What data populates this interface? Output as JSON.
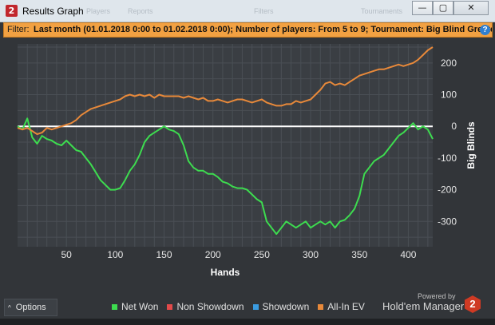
{
  "window": {
    "title": "Results Graph",
    "app_icon_text": "2",
    "background_menu_ghost": [
      "Players",
      "Reports",
      "Filters",
      "Tournaments"
    ],
    "controls": {
      "minimize": "—",
      "maximize": "▢",
      "close": "✕"
    }
  },
  "filter_bar": {
    "label": "Filter:",
    "text": "Last month (01.01.2018 0:00 to 01.02.2018 0:00); Number of players: From 5 to 9; Tournament: Big Blind Greater",
    "info_icon_text": "?",
    "color": "#f2a142"
  },
  "chart_data": {
    "type": "line",
    "xlabel": "Hands",
    "ylabel": "Big Blinds",
    "xlim": [
      0,
      425
    ],
    "ylim": [
      -380,
      260
    ],
    "x_ticks": [
      50,
      100,
      150,
      200,
      250,
      300,
      350,
      400
    ],
    "y_ticks": [
      200,
      100,
      0,
      -100,
      -200,
      -300
    ],
    "grid": true,
    "y_axis_side": "right",
    "legend_position": "bottom",
    "series": [
      {
        "name": "Net Won",
        "color": "#3ddc4f",
        "points": [
          [
            0,
            0
          ],
          [
            5,
            -10
          ],
          [
            10,
            25
          ],
          [
            15,
            -35
          ],
          [
            20,
            -55
          ],
          [
            25,
            -30
          ],
          [
            30,
            -40
          ],
          [
            35,
            -45
          ],
          [
            40,
            -55
          ],
          [
            45,
            -60
          ],
          [
            50,
            -45
          ],
          [
            55,
            -60
          ],
          [
            60,
            -75
          ],
          [
            65,
            -80
          ],
          [
            70,
            -100
          ],
          [
            75,
            -120
          ],
          [
            80,
            -145
          ],
          [
            85,
            -170
          ],
          [
            90,
            -185
          ],
          [
            95,
            -200
          ],
          [
            100,
            -200
          ],
          [
            105,
            -195
          ],
          [
            110,
            -170
          ],
          [
            115,
            -140
          ],
          [
            120,
            -120
          ],
          [
            125,
            -90
          ],
          [
            130,
            -50
          ],
          [
            135,
            -30
          ],
          [
            140,
            -20
          ],
          [
            145,
            -10
          ],
          [
            150,
            0
          ],
          [
            155,
            -10
          ],
          [
            160,
            -15
          ],
          [
            165,
            -25
          ],
          [
            170,
            -60
          ],
          [
            175,
            -110
          ],
          [
            180,
            -130
          ],
          [
            185,
            -140
          ],
          [
            190,
            -140
          ],
          [
            195,
            -150
          ],
          [
            200,
            -150
          ],
          [
            205,
            -160
          ],
          [
            210,
            -175
          ],
          [
            215,
            -180
          ],
          [
            220,
            -190
          ],
          [
            225,
            -195
          ],
          [
            230,
            -195
          ],
          [
            235,
            -200
          ],
          [
            240,
            -215
          ],
          [
            245,
            -230
          ],
          [
            250,
            -240
          ],
          [
            255,
            -300
          ],
          [
            260,
            -320
          ],
          [
            265,
            -340
          ],
          [
            270,
            -320
          ],
          [
            275,
            -300
          ],
          [
            280,
            -310
          ],
          [
            285,
            -320
          ],
          [
            290,
            -310
          ],
          [
            295,
            -300
          ],
          [
            300,
            -320
          ],
          [
            305,
            -310
          ],
          [
            310,
            -300
          ],
          [
            315,
            -310
          ],
          [
            320,
            -300
          ],
          [
            325,
            -320
          ],
          [
            330,
            -300
          ],
          [
            335,
            -295
          ],
          [
            340,
            -280
          ],
          [
            345,
            -260
          ],
          [
            350,
            -220
          ],
          [
            355,
            -150
          ],
          [
            360,
            -130
          ],
          [
            365,
            -110
          ],
          [
            370,
            -100
          ],
          [
            375,
            -90
          ],
          [
            380,
            -70
          ],
          [
            385,
            -50
          ],
          [
            390,
            -30
          ],
          [
            395,
            -20
          ],
          [
            400,
            -5
          ],
          [
            405,
            10
          ],
          [
            410,
            -10
          ],
          [
            415,
            0
          ],
          [
            420,
            -10
          ],
          [
            425,
            -40
          ]
        ]
      },
      {
        "name": "Non Showdown",
        "color": "#e34a4a",
        "points": []
      },
      {
        "name": "Showdown",
        "color": "#3a9be0",
        "points": []
      },
      {
        "name": "All-In EV",
        "color": "#e8893a",
        "points": [
          [
            0,
            -5
          ],
          [
            5,
            -10
          ],
          [
            10,
            -5
          ],
          [
            15,
            -15
          ],
          [
            20,
            -25
          ],
          [
            25,
            -20
          ],
          [
            30,
            -5
          ],
          [
            35,
            -10
          ],
          [
            40,
            -5
          ],
          [
            45,
            0
          ],
          [
            50,
            5
          ],
          [
            55,
            10
          ],
          [
            60,
            20
          ],
          [
            65,
            35
          ],
          [
            70,
            45
          ],
          [
            75,
            55
          ],
          [
            80,
            60
          ],
          [
            85,
            65
          ],
          [
            90,
            70
          ],
          [
            95,
            75
          ],
          [
            100,
            80
          ],
          [
            105,
            85
          ],
          [
            110,
            95
          ],
          [
            115,
            100
          ],
          [
            120,
            95
          ],
          [
            125,
            100
          ],
          [
            130,
            95
          ],
          [
            135,
            100
          ],
          [
            140,
            90
          ],
          [
            145,
            100
          ],
          [
            150,
            95
          ],
          [
            155,
            95
          ],
          [
            160,
            95
          ],
          [
            165,
            95
          ],
          [
            170,
            90
          ],
          [
            175,
            95
          ],
          [
            180,
            90
          ],
          [
            185,
            85
          ],
          [
            190,
            90
          ],
          [
            195,
            80
          ],
          [
            200,
            80
          ],
          [
            205,
            85
          ],
          [
            210,
            80
          ],
          [
            215,
            75
          ],
          [
            220,
            80
          ],
          [
            225,
            85
          ],
          [
            230,
            85
          ],
          [
            235,
            80
          ],
          [
            240,
            75
          ],
          [
            245,
            80
          ],
          [
            250,
            85
          ],
          [
            255,
            75
          ],
          [
            260,
            70
          ],
          [
            265,
            65
          ],
          [
            270,
            65
          ],
          [
            275,
            70
          ],
          [
            280,
            70
          ],
          [
            285,
            80
          ],
          [
            290,
            75
          ],
          [
            295,
            80
          ],
          [
            300,
            85
          ],
          [
            305,
            100
          ],
          [
            310,
            115
          ],
          [
            315,
            135
          ],
          [
            320,
            140
          ],
          [
            325,
            130
          ],
          [
            330,
            135
          ],
          [
            335,
            130
          ],
          [
            340,
            140
          ],
          [
            345,
            150
          ],
          [
            350,
            160
          ],
          [
            355,
            165
          ],
          [
            360,
            170
          ],
          [
            365,
            175
          ],
          [
            370,
            180
          ],
          [
            375,
            180
          ],
          [
            380,
            185
          ],
          [
            385,
            190
          ],
          [
            390,
            195
          ],
          [
            395,
            190
          ],
          [
            400,
            195
          ],
          [
            405,
            200
          ],
          [
            410,
            210
          ],
          [
            415,
            225
          ],
          [
            420,
            240
          ],
          [
            425,
            250
          ]
        ]
      }
    ]
  },
  "bottom_bar": {
    "options_label": "Options",
    "options_chevron": "^",
    "legend": [
      {
        "label": "Net Won",
        "color": "#3ddc4f"
      },
      {
        "label": "Non Showdown",
        "color": "#e34a4a"
      },
      {
        "label": "Showdown",
        "color": "#3a9be0"
      },
      {
        "label": "All-In EV",
        "color": "#e8893a"
      }
    ],
    "powered_by": "Powered by",
    "brand_name": "Hold'em Manager",
    "brand_logo_text": "2"
  }
}
